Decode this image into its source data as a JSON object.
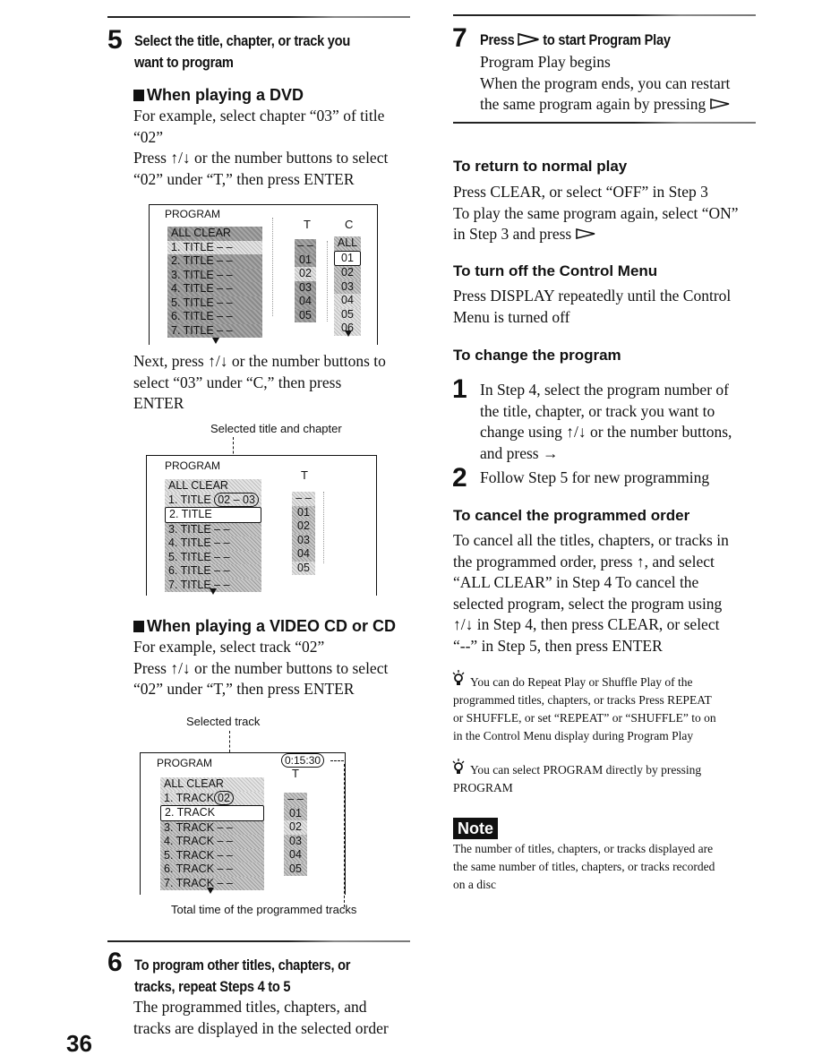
{
  "page_number": "36",
  "left": {
    "step5": {
      "number": "5",
      "heading_line1": "Select the title, chapter, or track you",
      "heading_line2": "want to program",
      "dvd": {
        "heading": "When playing a DVD",
        "lines": [
          "For example, select chapter “03” of title",
          "“02”",
          "Press ↑/↓ or the number buttons to select",
          "“02” under “T,” then press ENTER"
        ],
        "screen1": {
          "title": "PROGRAM",
          "col_t_label": "T",
          "col_c_label": "C",
          "rows": [
            "ALL CLEAR",
            "1. TITLE  – –",
            "2. TITLE  – –",
            "3. TITLE  – –",
            "4. TITLE  – –",
            "5. TITLE  – –",
            "6. TITLE  – –",
            "7. TITLE  – –"
          ],
          "t_values": [
            "– –",
            "01",
            "02",
            "03",
            "04",
            "05"
          ],
          "c_values": [
            "ALL",
            "01",
            "02",
            "03",
            "04",
            "05",
            "06"
          ]
        },
        "next_lines": [
          "Next, press ↑/↓ or the number buttons to",
          "select “03” under “C,” then press",
          "ENTER"
        ],
        "caption_selected": "Selected title and chapter",
        "screen2": {
          "title": "PROGRAM",
          "col_t_label": "T",
          "rows": [
            "ALL CLEAR",
            "1. TITLE",
            "2. TITLE",
            "3. TITLE  – –",
            "4. TITLE  – –",
            "5. TITLE  – –",
            "6. TITLE  – –",
            "7. TITLE  – –"
          ],
          "row1_value": "02 – 03",
          "t_values": [
            "– –",
            "01",
            "02",
            "03",
            "04",
            "05"
          ]
        }
      },
      "vcd": {
        "heading": "When playing a VIDEO CD or CD",
        "lines": [
          "For example, select track “02”",
          "Press ↑/↓ or the number buttons to select",
          "“02” under “T,” then press ENTER"
        ],
        "caption_selected": "Selected track",
        "screen3": {
          "title": "PROGRAM",
          "time": "0:15:30",
          "col_t_label": "T",
          "rows": [
            "ALL CLEAR",
            "1. TRACK",
            "2. TRACK",
            "3. TRACK  – –",
            "4. TRACK  – –",
            "5. TRACK  – –",
            "6. TRACK  – –",
            "7. TRACK  – –"
          ],
          "row1_value": "02",
          "t_values": [
            "– –",
            "01",
            "02",
            "03",
            "04",
            "05"
          ]
        },
        "caption_total": "Total time of the programmed tracks"
      }
    },
    "step6": {
      "number": "6",
      "heading_line1": "To program other titles, chapters, or",
      "heading_line2": "tracks, repeat Steps 4 to 5",
      "lines": [
        "The programmed titles, chapters, and",
        "tracks are displayed in the selected order"
      ]
    }
  },
  "right": {
    "step7": {
      "number": "7",
      "heading_pre": "Press",
      "heading_post": "to start Program Play",
      "line1": "Program Play begins",
      "line2": "When the program ends, you can restart",
      "line3": "the same program again by pressing"
    },
    "return_normal": {
      "heading": "To return to normal play",
      "line1": "Press CLEAR, or select “OFF” in Step 3",
      "line2": "To play the same program again, select “ON”",
      "line3": "in Step 3 and press"
    },
    "turn_off": {
      "heading": "To turn off the Control Menu",
      "lines": [
        "Press DISPLAY repeatedly until the Control",
        "Menu is turned off"
      ]
    },
    "change_program": {
      "heading": "To change the program",
      "step1_number": "1",
      "step1_lines": [
        "In Step 4, select the program number of",
        "the title, chapter, or track you want to",
        "change using ↑/↓ or the number buttons,",
        "and press →"
      ],
      "step2_number": "2",
      "step2_line": "Follow Step 5 for new programming"
    },
    "cancel_order": {
      "heading": "To cancel the programmed order",
      "lines": [
        "To cancel all the titles, chapters, or tracks in",
        "the programmed order, press ↑, and select",
        "“ALL CLEAR” in Step 4  To cancel the",
        "selected program, select the program using",
        "↑/↓ in Step 4, then press CLEAR, or select",
        "“--” in Step 5, then press ENTER"
      ]
    },
    "tip1": {
      "lines": [
        "You can do Repeat Play or Shuffle Play of the",
        "programmed titles, chapters, or tracks  Press REPEAT",
        "or SHUFFLE, or set “REPEAT” or “SHUFFLE” to on",
        "in the Control Menu display during Program Play"
      ]
    },
    "tip2": {
      "lines": [
        "You can select PROGRAM directly by pressing",
        "PROGRAM"
      ]
    },
    "note": {
      "badge": "Note",
      "lines": [
        "The number of titles, chapters, or tracks displayed are",
        "the same number of titles, chapters, or tracks recorded",
        "on a disc"
      ]
    }
  }
}
